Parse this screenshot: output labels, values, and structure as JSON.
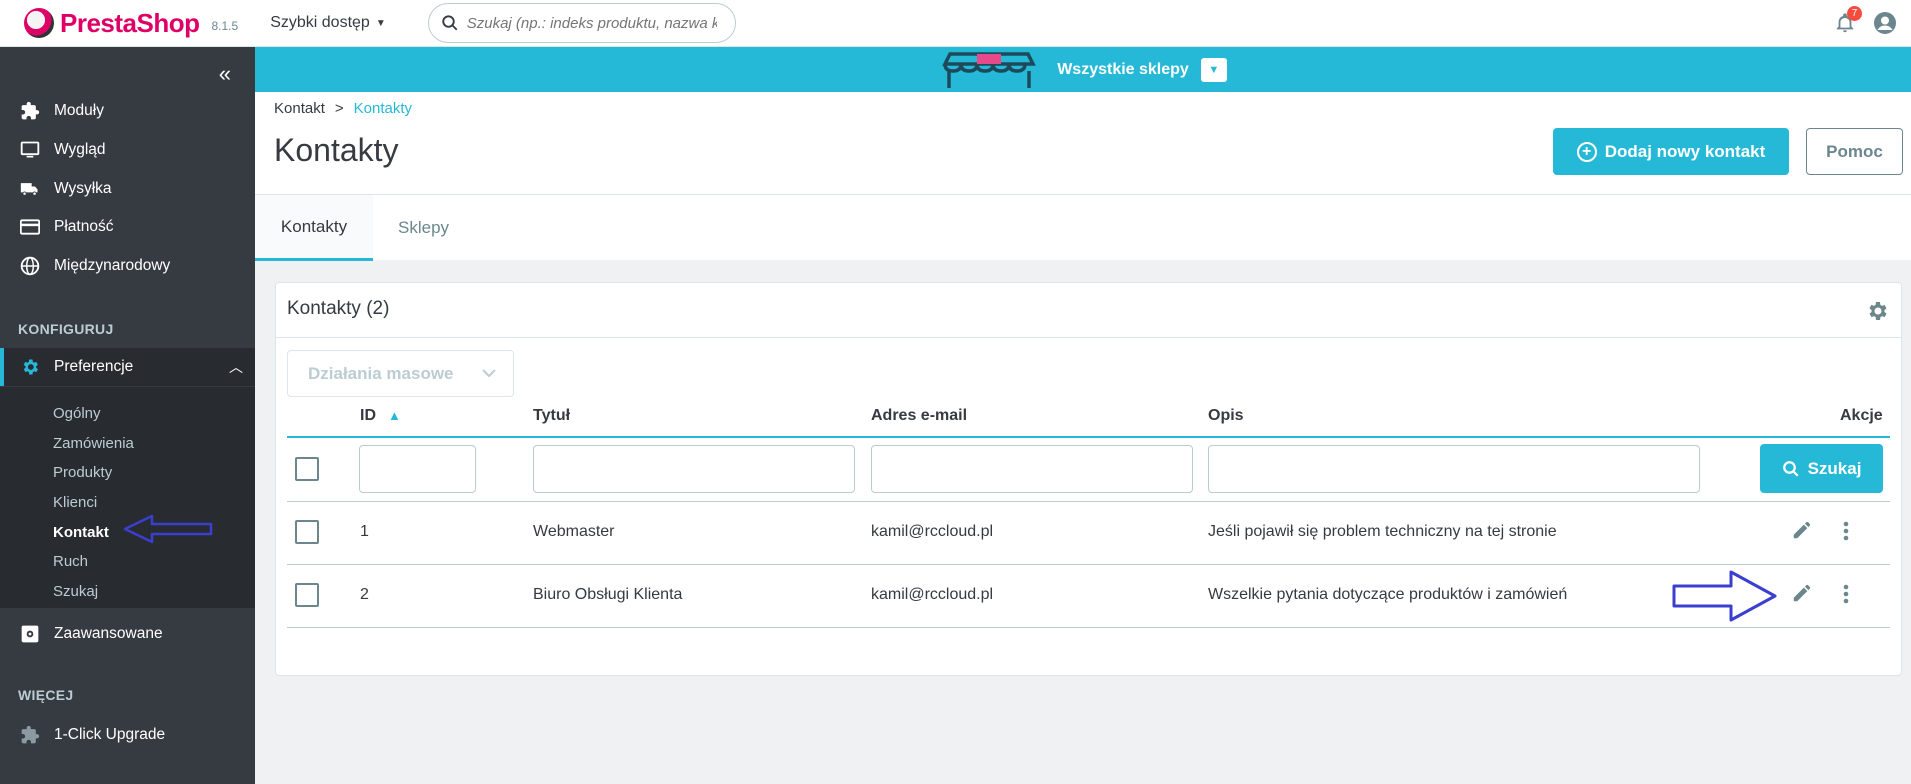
{
  "header": {
    "brand_a": "Presta",
    "brand_b": "Shop",
    "version": "8.1.5",
    "quick_access": "Szybki dostęp",
    "search_placeholder": "Szukaj (np.: indeks produktu, nazwa ki",
    "notifications_count": "7"
  },
  "sidebar": {
    "items": [
      {
        "label": "Moduły",
        "icon": "puzzle-icon"
      },
      {
        "label": "Wygląd",
        "icon": "monitor-icon"
      },
      {
        "label": "Wysyłka",
        "icon": "truck-icon"
      },
      {
        "label": "Płatność",
        "icon": "credit-card-icon"
      },
      {
        "label": "Międzynarodowy",
        "icon": "globe-icon"
      }
    ],
    "section_configure": "KONFIGURUJ",
    "preferences": "Preferencje",
    "submenu": [
      "Ogólny",
      "Zamówienia",
      "Produkty",
      "Klienci",
      "Kontakt",
      "Ruch",
      "Szukaj"
    ],
    "advanced": "Zaawansowane",
    "section_more": "WIĘCEJ",
    "upgrade": "1-Click Upgrade"
  },
  "shop_bar": {
    "label": "Wszystkie sklepy"
  },
  "page": {
    "breadcrumb_parent": "Kontakt",
    "breadcrumb_current": "Kontakty",
    "title": "Kontakty",
    "add_button": "Dodaj nowy kontakt",
    "help_button": "Pomoc"
  },
  "tabs": [
    "Kontakty",
    "Sklepy"
  ],
  "panel": {
    "title": "Kontakty (2)",
    "bulk_actions": "Działania masowe",
    "columns": [
      "ID",
      "Tytuł",
      "Adres e-mail",
      "Opis",
      "Akcje"
    ],
    "search_button": "Szukaj",
    "rows": [
      {
        "id": "1",
        "title": "Webmaster",
        "email": "kamil@rccloud.pl",
        "description": "Jeśli pojawił się problem techniczny na tej stronie"
      },
      {
        "id": "2",
        "title": "Biuro Obsługi Klienta",
        "email": "kamil@rccloud.pl",
        "description": "Wszelkie pytania dotyczące produktów i zamówień"
      }
    ]
  },
  "colors": {
    "accent": "#25b9d7",
    "sidebar": "#363a41",
    "annotation_arrow": "#3a3fcf"
  }
}
